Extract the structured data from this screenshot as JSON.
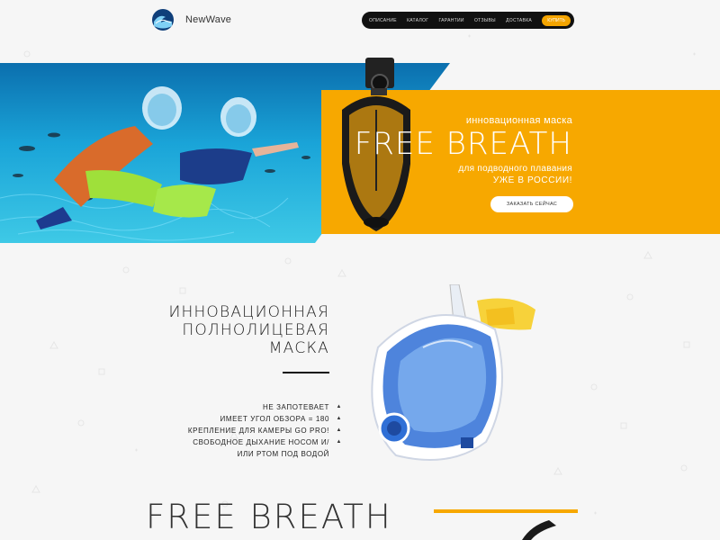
{
  "brand": {
    "name": "NewWave",
    "logo_icon": "wave-circle-icon"
  },
  "nav": {
    "items": [
      "Описание",
      "Каталог",
      "Гарантии",
      "Отзывы",
      "Доставка"
    ],
    "cta": "Купить"
  },
  "hero": {
    "subtitle": "инновационная маска",
    "title": "FREE BREATH",
    "line2": "для подводного плавания",
    "line3": "УЖЕ В РОССИИ!",
    "button": "Заказать сейчас"
  },
  "features": {
    "title": [
      "ИННОВАЦИОННАЯ",
      "ПОЛНОЛИЦЕВАЯ",
      "МАСКА"
    ],
    "items": [
      "Не запотевает",
      "Имеет угол обзора = 180",
      "Крепление для камеры GO PRO!",
      "Свободное дыхание носом и/или ртом под водой"
    ]
  },
  "bottom": {
    "title": "FREE BREATH"
  },
  "colors": {
    "accent": "#f7a800",
    "nav_bg": "#111111",
    "mask_blue": "#2f6fd6"
  }
}
